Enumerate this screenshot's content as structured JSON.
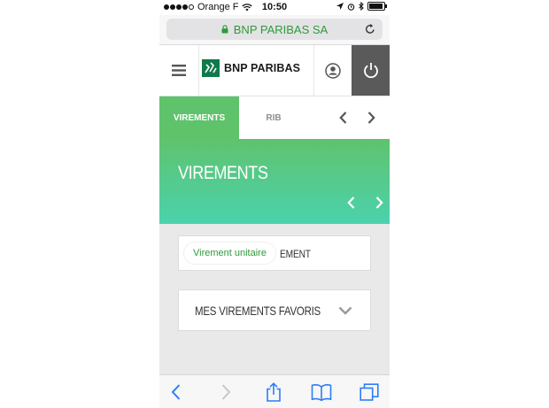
{
  "status_bar": {
    "carrier": "Orange F",
    "time": "10:50"
  },
  "address_bar": {
    "site": "BNP PARIBAS SA"
  },
  "header": {
    "brand": "BNP PARIBAS"
  },
  "tabs": [
    {
      "label": "VIREMENTS",
      "active": true
    },
    {
      "label": "RIB",
      "active": false
    }
  ],
  "banner": {
    "title": "VIREMENTS"
  },
  "cards": {
    "transfer_pill": "Virement unitaire",
    "transfer_behind": "EMENT",
    "favorites": "MES VIREMENTS FAVORIS"
  },
  "colors": {
    "accent_green": "#5fc36c",
    "gradient_end": "#4bd2ad",
    "ios_blue": "#2f7cf6",
    "power_bg": "#5a5a5a"
  },
  "icons": [
    "signal-dots-icon",
    "wifi-icon",
    "location-icon",
    "alarm-icon",
    "bluetooth-icon",
    "battery-icon",
    "lock-icon",
    "reload-icon",
    "hamburger-icon",
    "brand-logo-icon",
    "user-icon",
    "power-icon",
    "chevron-left-icon",
    "chevron-right-icon",
    "chevron-down-icon",
    "share-icon",
    "bookmarks-icon",
    "tabs-icon"
  ]
}
